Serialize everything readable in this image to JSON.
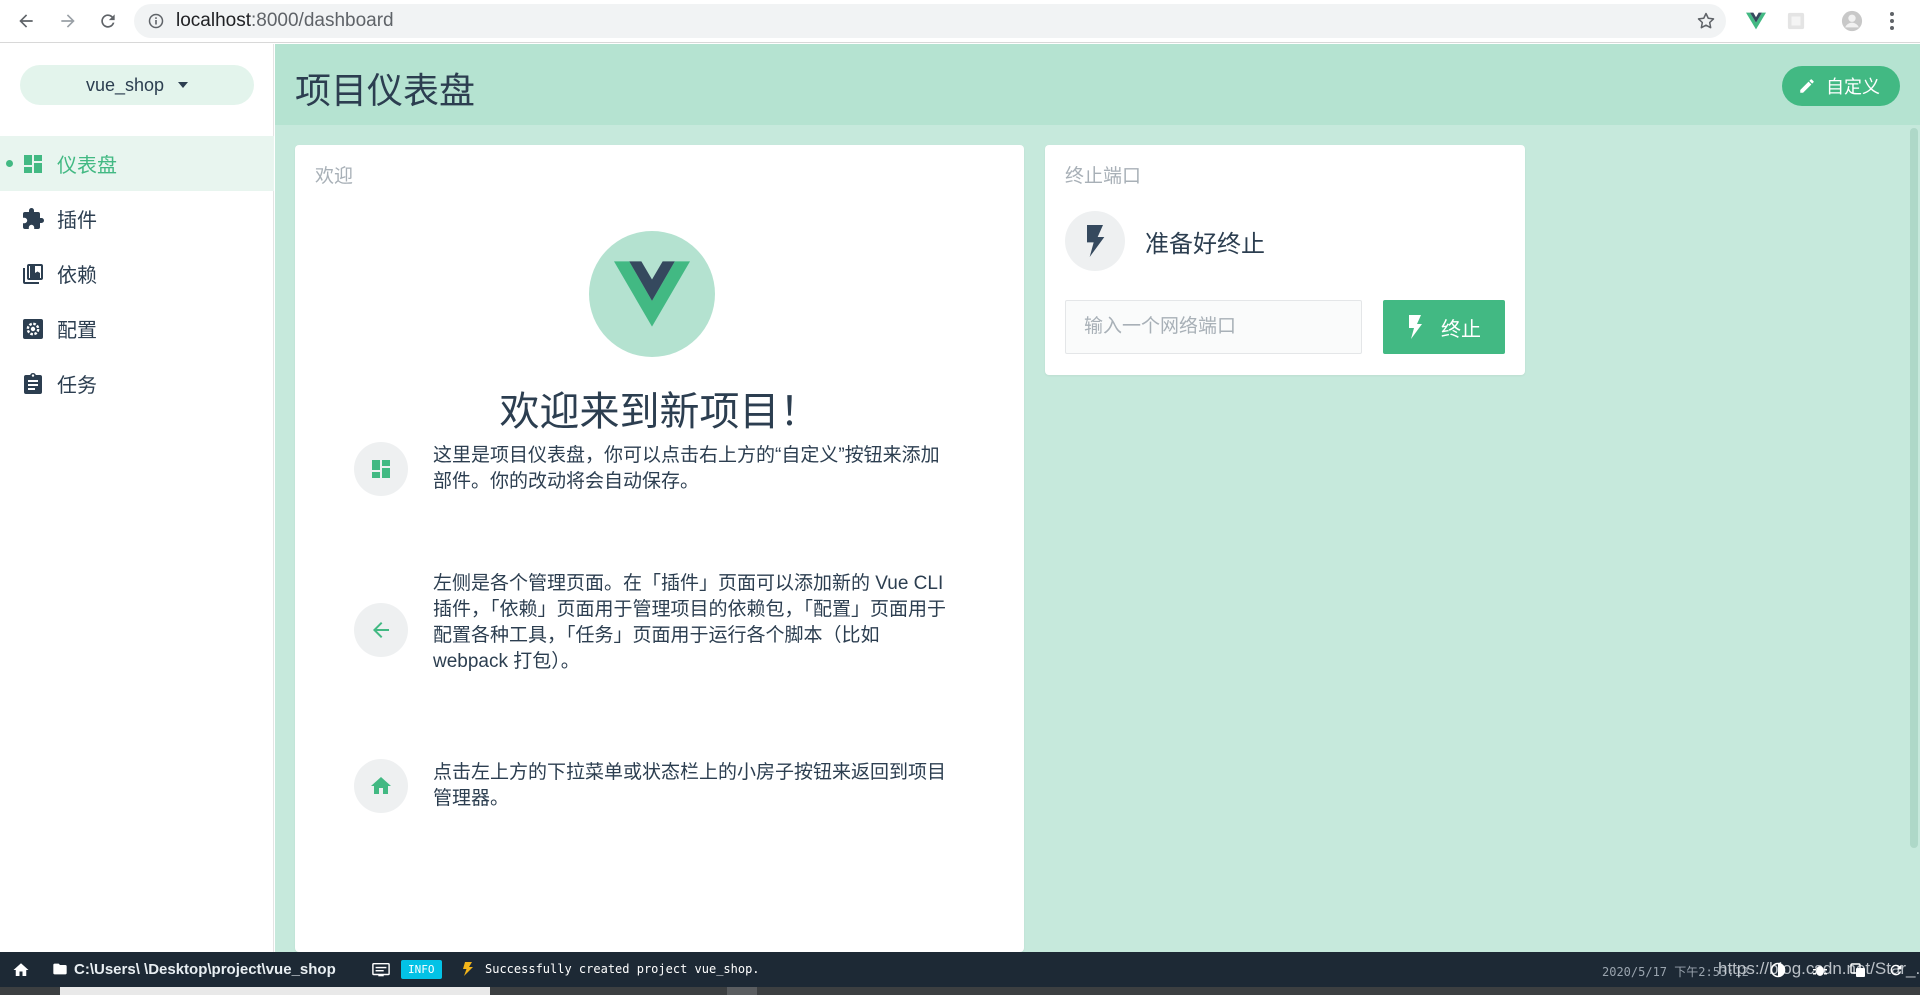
{
  "browser": {
    "url_host": "localhost",
    "url_path": ":8000/dashboard"
  },
  "sidebar": {
    "project_name": "vue_shop",
    "items": [
      {
        "label": "仪表盘",
        "icon": "dashboard-icon",
        "active": true
      },
      {
        "label": "插件",
        "icon": "puzzle-icon",
        "active": false
      },
      {
        "label": "依赖",
        "icon": "library-icon",
        "active": false
      },
      {
        "label": "配置",
        "icon": "settings-icon",
        "active": false
      },
      {
        "label": "任务",
        "icon": "clipboard-icon",
        "active": false
      }
    ]
  },
  "header": {
    "title": "项目仪表盘",
    "customize_label": "自定义"
  },
  "welcome_card": {
    "title": "欢迎",
    "heading": "欢迎来到新项目！",
    "tips": [
      {
        "icon": "dashboard-icon",
        "text": "这里是项目仪表盘，你可以点击右上方的“自定义”按钮来添加部件。你的改动将会自动保存。"
      },
      {
        "icon": "arrow-left-icon",
        "text": "左侧是各个管理页面。在「插件」页面可以添加新的 Vue CLI 插件，「依赖」页面用于管理项目的依赖包，「配置」页面用于配置各种工具，「任务」页面用于运行各个脚本（比如 webpack 打包）。"
      },
      {
        "icon": "home-icon",
        "text": "点击左上方的下拉菜单或状态栏上的小房子按钮来返回到项目管理器。"
      }
    ]
  },
  "kill_port_card": {
    "title": "终止端口",
    "status": "准备好终止",
    "input_placeholder": "输入一个网络端口",
    "button_label": "终止"
  },
  "statusbar": {
    "path": "C:\\Users\\      \\Desktop\\project\\vue_shop",
    "badge": "INFO",
    "message": "Successfully created project vue_shop.",
    "time": "2020/5/17 下午2:53:12",
    "watermark": "https://blog.csdn.net/Star_..."
  },
  "colors": {
    "accent": "#42b983",
    "topbar": "#b5e3d1",
    "main_bg": "#c6e9dc",
    "statusbar": "#1d2935",
    "vue_dark": "#35495e"
  }
}
